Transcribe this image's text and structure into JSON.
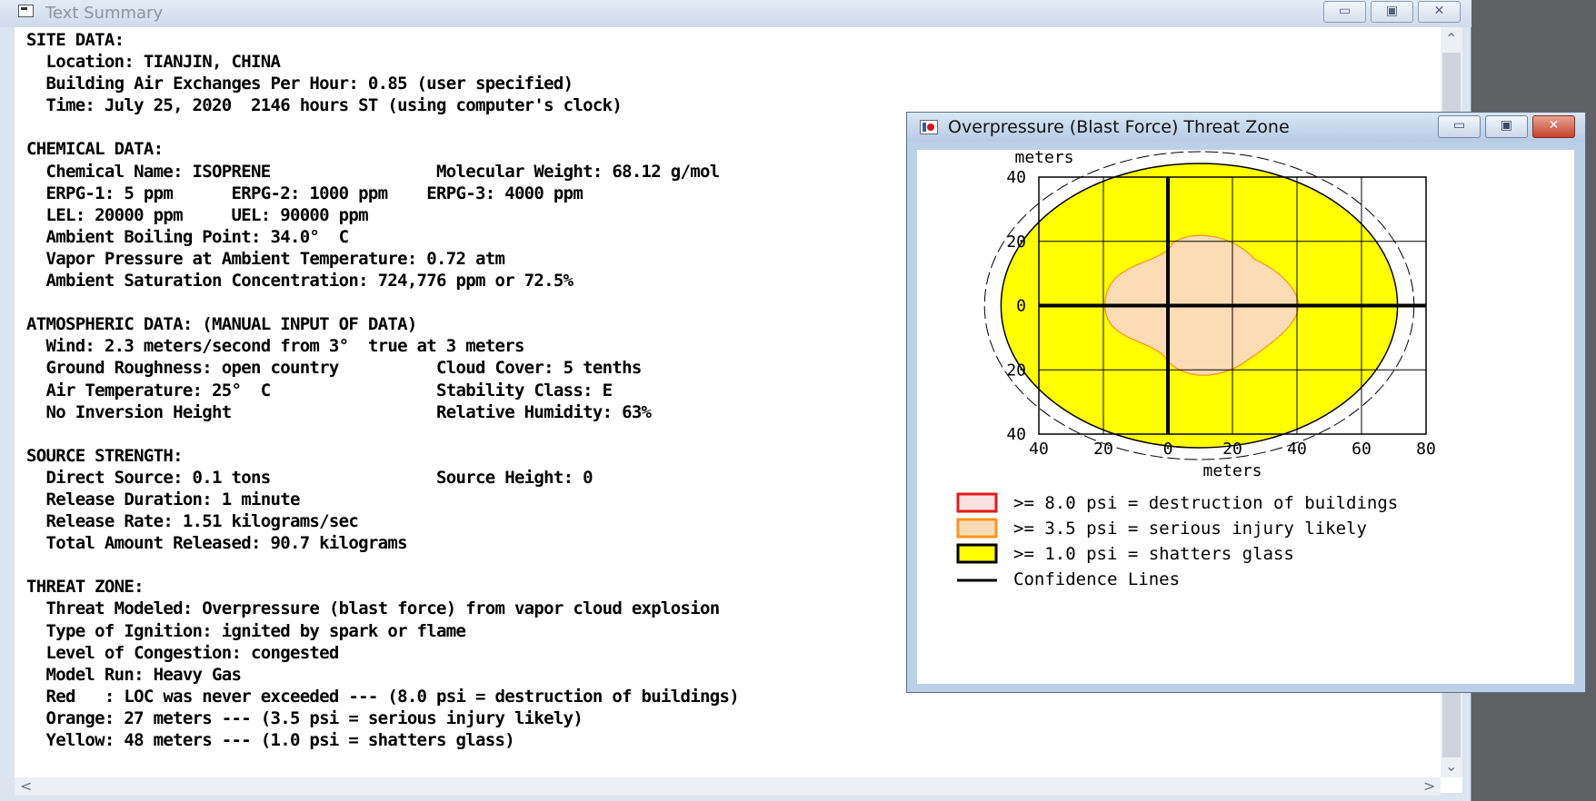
{
  "text_summary": {
    "title": "Text Summary",
    "caption_buttons": {
      "minimize": "▭",
      "maximize": "▣",
      "close": "✕"
    },
    "lines": [
      "SITE DATA:",
      "  Location: TIANJIN, CHINA",
      "  Building Air Exchanges Per Hour: 0.85 (user specified)",
      "  Time: July 25, 2020  2146 hours ST (using computer's clock)",
      "",
      "CHEMICAL DATA:",
      "  Chemical Name: ISOPRENE                 Molecular Weight: 68.12 g/mol",
      "  ERPG-1: 5 ppm      ERPG-2: 1000 ppm    ERPG-3: 4000 ppm",
      "  LEL: 20000 ppm     UEL: 90000 ppm",
      "  Ambient Boiling Point: 34.0°  C",
      "  Vapor Pressure at Ambient Temperature: 0.72 atm",
      "  Ambient Saturation Concentration: 724,776 ppm or 72.5%",
      "",
      "ATMOSPHERIC DATA: (MANUAL INPUT OF DATA)",
      "  Wind: 2.3 meters/second from 3°  true at 3 meters",
      "  Ground Roughness: open country          Cloud Cover: 5 tenths",
      "  Air Temperature: 25°  C                 Stability Class: E",
      "  No Inversion Height                     Relative Humidity: 63%",
      "",
      "SOURCE STRENGTH:",
      "  Direct Source: 0.1 tons                 Source Height: 0",
      "  Release Duration: 1 minute",
      "  Release Rate: 1.51 kilograms/sec",
      "  Total Amount Released: 90.7 kilograms",
      "",
      "THREAT ZONE:",
      "  Threat Modeled: Overpressure (blast force) from vapor cloud explosion",
      "  Type of Ignition: ignited by spark or flame",
      "  Level of Congestion: congested",
      "  Model Run: Heavy Gas",
      "  Red   : LOC was never exceeded --- (8.0 psi = destruction of buildings)",
      "  Orange: 27 meters --- (3.5 psi = serious injury likely)",
      "  Yellow: 48 meters --- (1.0 psi = shatters glass)"
    ],
    "scroll_arrows": {
      "up": "⌃",
      "down": "⌄",
      "left": "<",
      "right": ">"
    }
  },
  "threat_zone_window": {
    "title": "Overpressure (Blast Force) Threat Zone",
    "caption_buttons": {
      "minimize": "▭",
      "maximize": "▣",
      "close": "✕"
    },
    "chart_data": {
      "type": "threat-zone-plot",
      "ylabel": "meters",
      "xlabel": "meters",
      "x_ticks": [
        "40",
        "20",
        "0",
        "20",
        "40",
        "60",
        "80"
      ],
      "y_ticks": [
        "40",
        "20",
        "0",
        "20",
        "40"
      ],
      "xlim": [
        -40,
        80
      ],
      "ylim": [
        -40,
        40
      ],
      "grid": true,
      "zones": [
        {
          "level": "yellow",
          "radius_m": 48,
          "fill": "#ffff00"
        },
        {
          "level": "orange",
          "radius_m": 27,
          "fill": "#fcdcb4"
        }
      ],
      "confidence_line_radius_m": 52,
      "legend": [
        {
          "swatch": "red",
          "border": "#e3191b",
          "fill": "#fbe1e1",
          "label": ">= 8.0 psi = destruction of buildings"
        },
        {
          "swatch": "orange",
          "border": "#f7931e",
          "fill": "#fcdcb4",
          "label": ">= 3.5 psi = serious injury likely"
        },
        {
          "swatch": "yellow",
          "border": "#000000",
          "fill": "#ffff00",
          "label": ">= 1.0 psi = shatters glass"
        },
        {
          "swatch": "line",
          "border": "#000000",
          "fill": "none",
          "label": "Confidence Lines"
        }
      ]
    }
  }
}
